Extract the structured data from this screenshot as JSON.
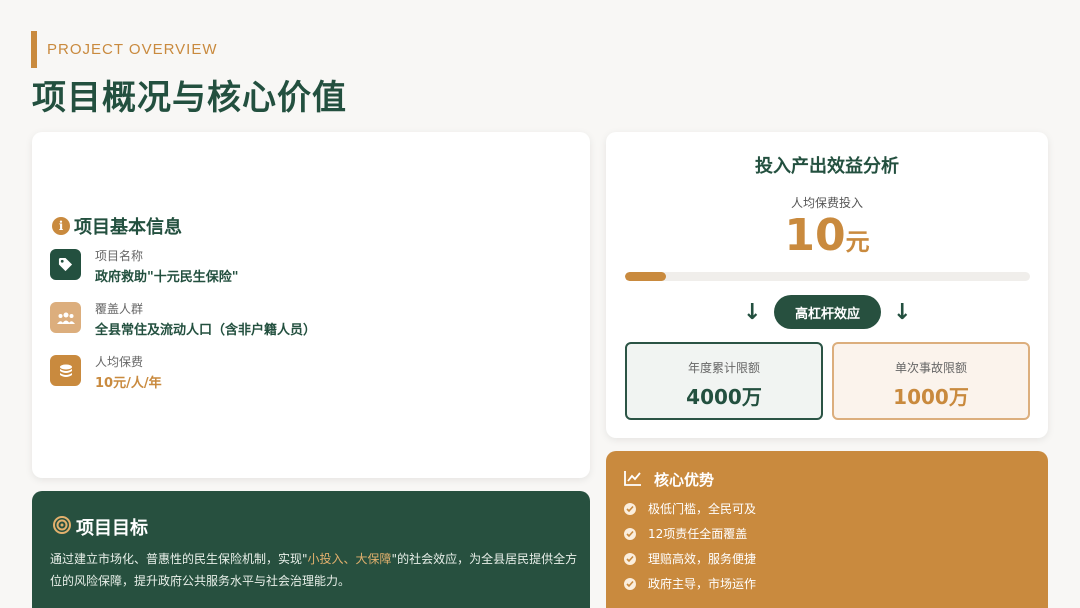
{
  "header": {
    "eyebrow": "PROJECT OVERVIEW",
    "title": "项目概况与核心价值"
  },
  "basic_info": {
    "title": "项目基本信息",
    "items": [
      {
        "label": "项目名称",
        "value": "政府救助\"十元民生保险\"",
        "icon": "tag-icon"
      },
      {
        "label": "覆盖人群",
        "value": "全县常住及流动人口（含非户籍人员）",
        "icon": "users-icon"
      },
      {
        "label": "人均保费",
        "value": "10元/人/年",
        "icon": "coins-icon"
      }
    ]
  },
  "goal": {
    "title": "项目目标",
    "text_before": "通过建立市场化、普惠性的民生保险机制，实现\"",
    "highlight": "小投入、大保障",
    "text_after": "\"的社会效应，为全县居民提供全方位的风险保障，提升政府公共服务水平与社会治理能力。"
  },
  "roi": {
    "title": "投入产出效益分析",
    "subtitle": "人均保费投入",
    "amount": "10",
    "unit": "元",
    "bar_fill_fraction": 0.1,
    "pill": "高杠杆效应",
    "limits": [
      {
        "label": "年度累计限额",
        "value": "4000万"
      },
      {
        "label": "单次事故限额",
        "value": "1000万"
      }
    ]
  },
  "advantages": {
    "title": "核心优势",
    "items": [
      "极低门槛，全民可及",
      "12项责任全面覆盖",
      "理赔高效，服务便捷",
      "政府主导，市场运作"
    ]
  },
  "colors": {
    "primary_green": "#23503f",
    "accent_gold": "#c98a3e",
    "tan": "#dcae7d"
  }
}
